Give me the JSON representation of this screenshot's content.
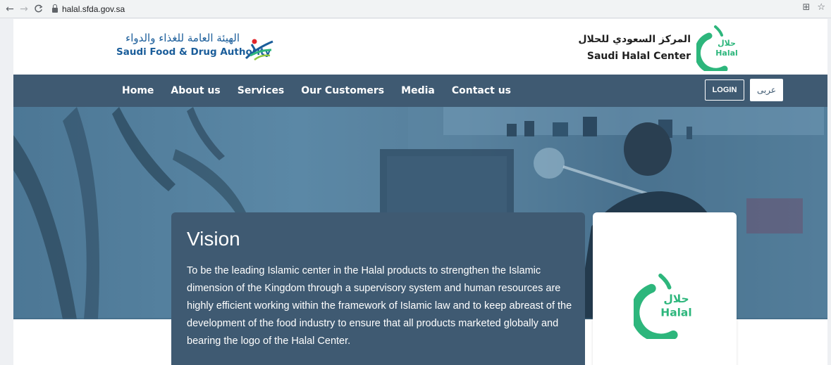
{
  "browser": {
    "url": "halal.sfda.gov.sa",
    "back_icon": "←",
    "forward_icon": "→",
    "reload_icon": "C",
    "translate_icon": "⊞",
    "star_icon": "☆"
  },
  "header": {
    "sfda_name_ar": "الهيئة العامة للغذاء والدواء",
    "sfda_name_en": "Saudi Food & Drug Authority",
    "center_name_ar": "المركز السعودي للحلال",
    "center_name_en": "Saudi Halal Center"
  },
  "logo": {
    "ar": "حلال",
    "en": "Halal"
  },
  "nav": {
    "items": [
      {
        "label": "Home"
      },
      {
        "label": "About us"
      },
      {
        "label": "Services"
      },
      {
        "label": "Our Customers"
      },
      {
        "label": "Media"
      },
      {
        "label": "Contact us"
      }
    ],
    "login_label": "LOGIN",
    "lang_label": "عربى"
  },
  "vision": {
    "title": "Vision",
    "text": "To be the leading Islamic center in the Halal products to strengthen the Islamic dimension of the Kingdom through a supervisory system and human resources are highly efficient working within the framework of Islamic law and to keep abreast of the development of the food industry to ensure that all products marketed globally and bearing the logo of the Halal Center."
  },
  "colors": {
    "nav_bg": "#3f5a72",
    "brand_green": "#2db67c",
    "sfda_blue": "#1a5d9a"
  }
}
